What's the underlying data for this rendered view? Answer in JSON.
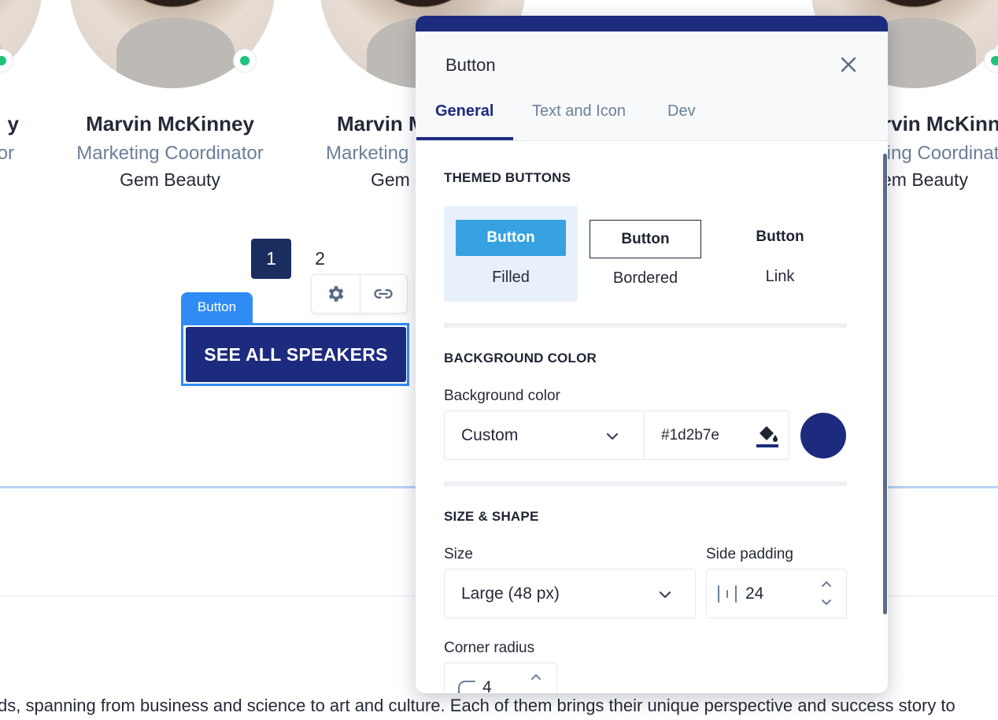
{
  "speakers": [
    {
      "name": "y",
      "role": "or",
      "company": ""
    },
    {
      "name": "Marvin McKinney",
      "role": "Marketing Coordinator",
      "company": "Gem Beauty"
    },
    {
      "name": "Marvin M",
      "role": "Marketing",
      "company": "Gem B"
    },
    {
      "name": "rvin McKinne",
      "role": "ting Coordinat",
      "company": "em Beauty"
    }
  ],
  "pagination": {
    "pages": [
      "1",
      "2"
    ],
    "active": "1"
  },
  "toolbar": {
    "settings_icon": "gear-icon",
    "link_icon": "link-icon"
  },
  "selection": {
    "tag_label": "Button"
  },
  "cta": {
    "label": "SEE ALL SPEAKERS",
    "background": "#1d2b7e"
  },
  "paragraph": "ds, spanning from business and science to art and culture. Each of them brings their unique perspective and success story to",
  "panel": {
    "title": "Button",
    "close_icon": "close-icon",
    "tabs": [
      "General",
      "Text and Icon",
      "Dev"
    ],
    "active_tab": "General",
    "themed_buttons": {
      "title": "THEMED BUTTONS",
      "options": [
        {
          "button_label": "Button",
          "caption": "Filled",
          "selected": true
        },
        {
          "button_label": "Button",
          "caption": "Bordered",
          "selected": false
        },
        {
          "button_label": "Button",
          "caption": "Link",
          "selected": false
        }
      ]
    },
    "background_color": {
      "title": "BACKGROUND COLOR",
      "label": "Background color",
      "mode": "Custom",
      "hex": "#1d2b7e",
      "picker_icon": "paint-bucket-icon",
      "swatch": "#1d2b7e"
    },
    "size_shape": {
      "title": "SIZE & SHAPE",
      "size_label": "Size",
      "size_value": "Large (48 px)",
      "padding_label": "Side padding",
      "padding_value": "24",
      "radius_label": "Corner radius",
      "radius_value": "4"
    }
  },
  "colors": {
    "accent": "#2f8cf5",
    "brand": "#1d2b7e",
    "status_online": "#1fc27a",
    "muted": "#6b7f98"
  }
}
